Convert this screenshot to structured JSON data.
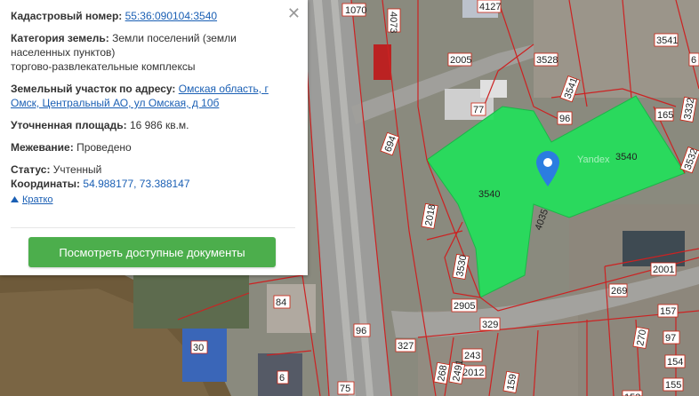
{
  "popup": {
    "cadastral_label": "Кадастровый номер:",
    "cadastral_value": "55:36:090104:3540",
    "category_label": "Категория земель:",
    "category_value_1": "Земли поселений (земли",
    "category_value_2": "населенных пунктов)",
    "category_value_3": "торгово-развлекательные комплексы",
    "address_label": "Земельный участок по адресу:",
    "address_value_1": "Омская область, г",
    "address_value_2": "Омск, Центральный АО, ул Омская, д 10б",
    "area_label": "Уточненная площадь:",
    "area_value": "16 986 кв.м.",
    "survey_label": "Межевание:",
    "survey_value": "Проведено",
    "status_label": "Статус:",
    "status_value": "Учтенный",
    "coords_label": "Координаты:",
    "coords_value": "54.988177, 73.388147",
    "collapse_label": "Кратко",
    "docs_button": "Посмотреть доступные документы",
    "close_icon": "close-icon"
  },
  "map": {
    "watermark": "Yandex",
    "highlight_color": "#22e05a",
    "boundary_color": "#cc2222",
    "plots": [
      "1070",
      "4073",
      "4127",
      "3541",
      "3528",
      "2005",
      "6",
      "3541",
      "77",
      "96",
      "165",
      "3332",
      "3540",
      "3532",
      "3540",
      "694",
      "4035",
      "2018",
      "3530",
      "2905",
      "329",
      "2001",
      "269",
      "157",
      "84",
      "30",
      "96",
      "327",
      "97",
      "155",
      "154",
      "2012",
      "243",
      "75",
      "6",
      "270",
      "153",
      "268",
      "159",
      "2491"
    ],
    "marker_icon": "map-pin-icon"
  }
}
